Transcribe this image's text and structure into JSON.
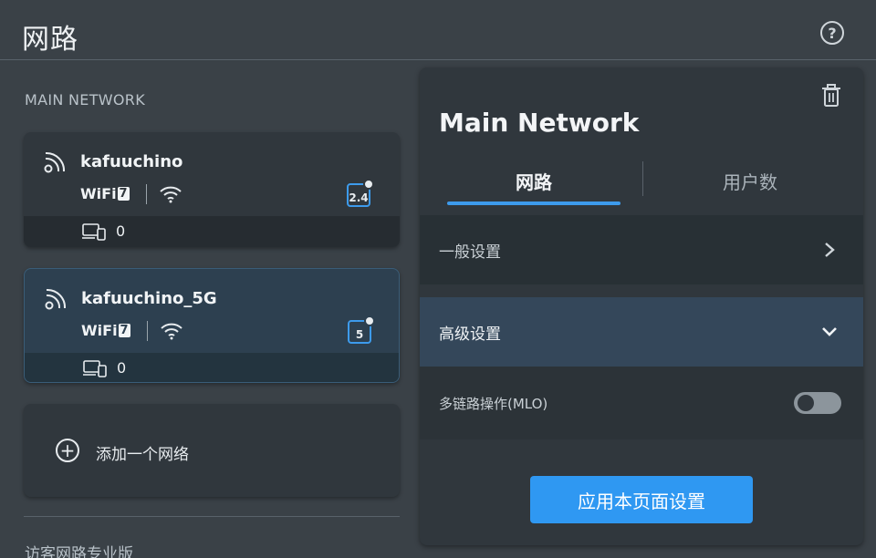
{
  "header": {
    "title": "网路",
    "help_glyph": "?"
  },
  "left": {
    "section_label": "MAIN NETWORK",
    "networks": [
      {
        "ssid": "kafuuchino",
        "wifi_label": "WiFi",
        "wifi_gen": "7",
        "band": "2.4",
        "device_count": "0",
        "selected": false
      },
      {
        "ssid": "kafuuchino_5G",
        "wifi_label": "WiFi",
        "wifi_gen": "7",
        "band": "5",
        "device_count": "0",
        "selected": true
      }
    ],
    "add_network_label": "添加一个网络",
    "add_glyph": "+",
    "guest_label": "访客网路专业版"
  },
  "panel": {
    "title": "Main Network",
    "tabs": [
      {
        "label": "网路",
        "active": true
      },
      {
        "label": "用户数",
        "active": false
      }
    ],
    "general_settings_label": "一般设置",
    "advanced_settings_label": "高级设置",
    "mlo_label": "多链路操作(MLO)",
    "mlo_enabled": false,
    "apply_button_label": "应用本页面设置"
  },
  "colors": {
    "accent": "#2f98f2",
    "background": "#3a4147",
    "card": "#30373d"
  },
  "icons": [
    "help-icon",
    "signal-icon",
    "wifi-icon",
    "device-icon",
    "plus-icon",
    "trash-icon",
    "chevron-right-icon",
    "chevron-down-icon"
  ]
}
